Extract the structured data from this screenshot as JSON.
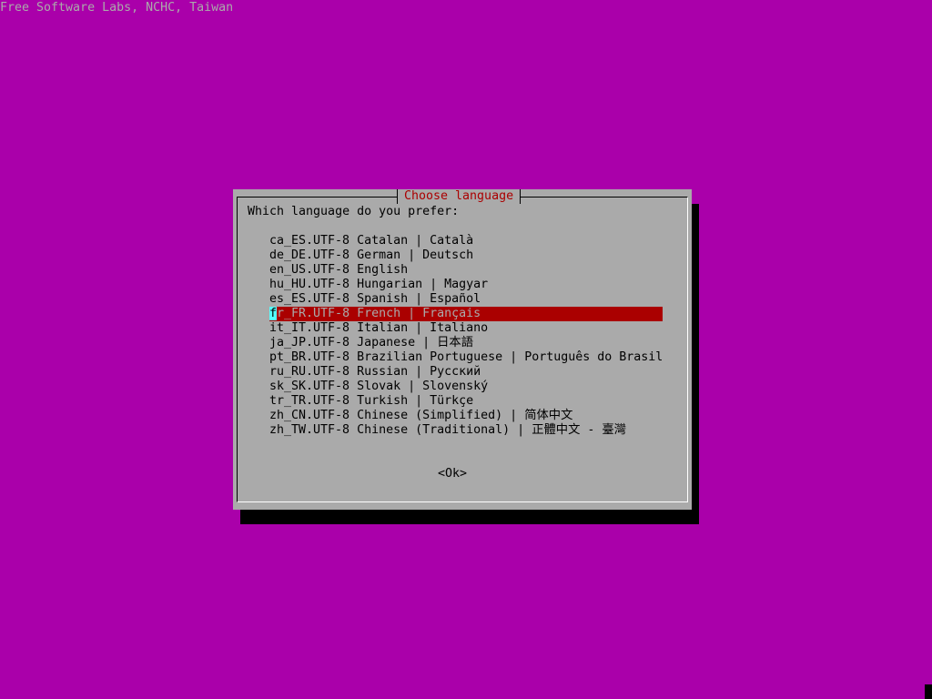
{
  "header": {
    "text": "Free Software Labs, NCHC, Taiwan"
  },
  "dialog": {
    "title": "Choose language",
    "prompt": "Which language do you prefer:",
    "items": [
      {
        "label": "ca_ES.UTF-8 Catalan | Català"
      },
      {
        "label": "de_DE.UTF-8 German | Deutsch"
      },
      {
        "label": "en_US.UTF-8 English"
      },
      {
        "label": "hu_HU.UTF-8 Hungarian | Magyar"
      },
      {
        "label": "es_ES.UTF-8 Spanish | Español"
      },
      {
        "label": "fr_FR.UTF-8 French | Français",
        "hotkey": "f",
        "rest": "r_FR.UTF-8 French | Français"
      },
      {
        "label": "it_IT.UTF-8 Italian | Italiano"
      },
      {
        "label": "ja_JP.UTF-8 Japanese | 日本語"
      },
      {
        "label": "pt_BR.UTF-8 Brazilian Portuguese | Português do Brasil"
      },
      {
        "label": "ru_RU.UTF-8 Russian | Русский"
      },
      {
        "label": "sk_SK.UTF-8 Slovak | Slovenský"
      },
      {
        "label": "tr_TR.UTF-8 Turkish | Türkçe"
      },
      {
        "label": "zh_CN.UTF-8 Chinese (Simplified) | 简体中文"
      },
      {
        "label": "zh_TW.UTF-8 Chinese (Traditional) | 正體中文 - 臺灣"
      }
    ],
    "selected_index": 5,
    "ok_label": "<Ok>"
  },
  "colors": {
    "background": "#aa00aa",
    "dialog": "#aaaaaa",
    "shadow": "#000000",
    "title": "#aa0000",
    "selection": "#aa0000",
    "cursor": "#55ffff",
    "header_text": "#aaaaaa"
  }
}
